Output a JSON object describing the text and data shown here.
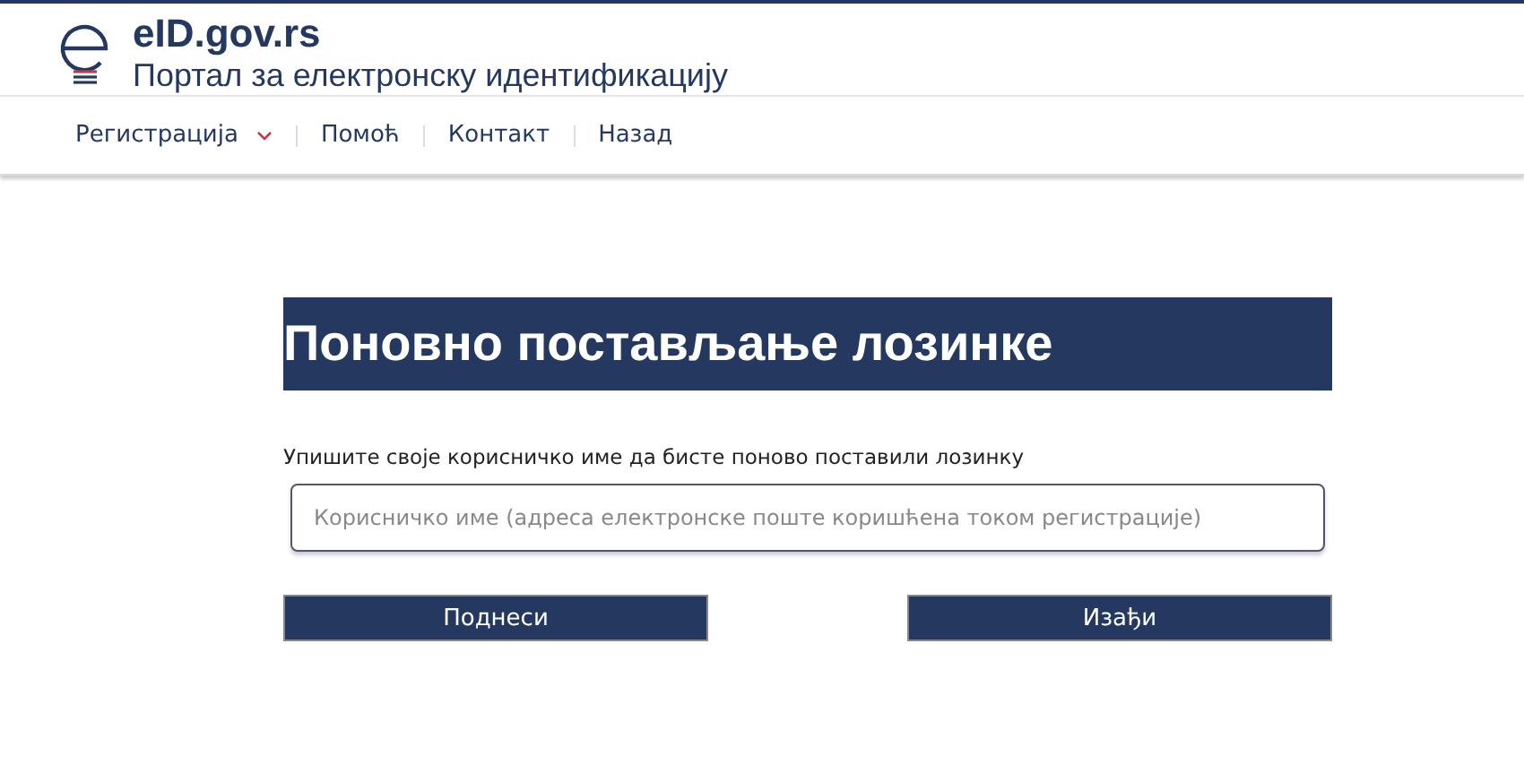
{
  "header": {
    "site_name": "eID.gov.rs",
    "subtitle": "Портал за електронску идентификацију"
  },
  "nav": [
    {
      "label": "Регистрација",
      "has_menu": true
    },
    {
      "label": "Помоћ",
      "has_menu": false
    },
    {
      "label": "Контакт",
      "has_menu": false
    },
    {
      "label": "Назад",
      "has_menu": false
    }
  ],
  "form": {
    "title": "Поновно постављање лозинке",
    "instruction": "Упишите своје корисничко име да бисте поново поставили лозинку",
    "username": {
      "placeholder": "Корисничко име (адреса електронске поште коришћена током регистрације)"
    },
    "buttons": [
      {
        "label": "Поднеси"
      },
      {
        "label": "Изађи"
      }
    ]
  }
}
